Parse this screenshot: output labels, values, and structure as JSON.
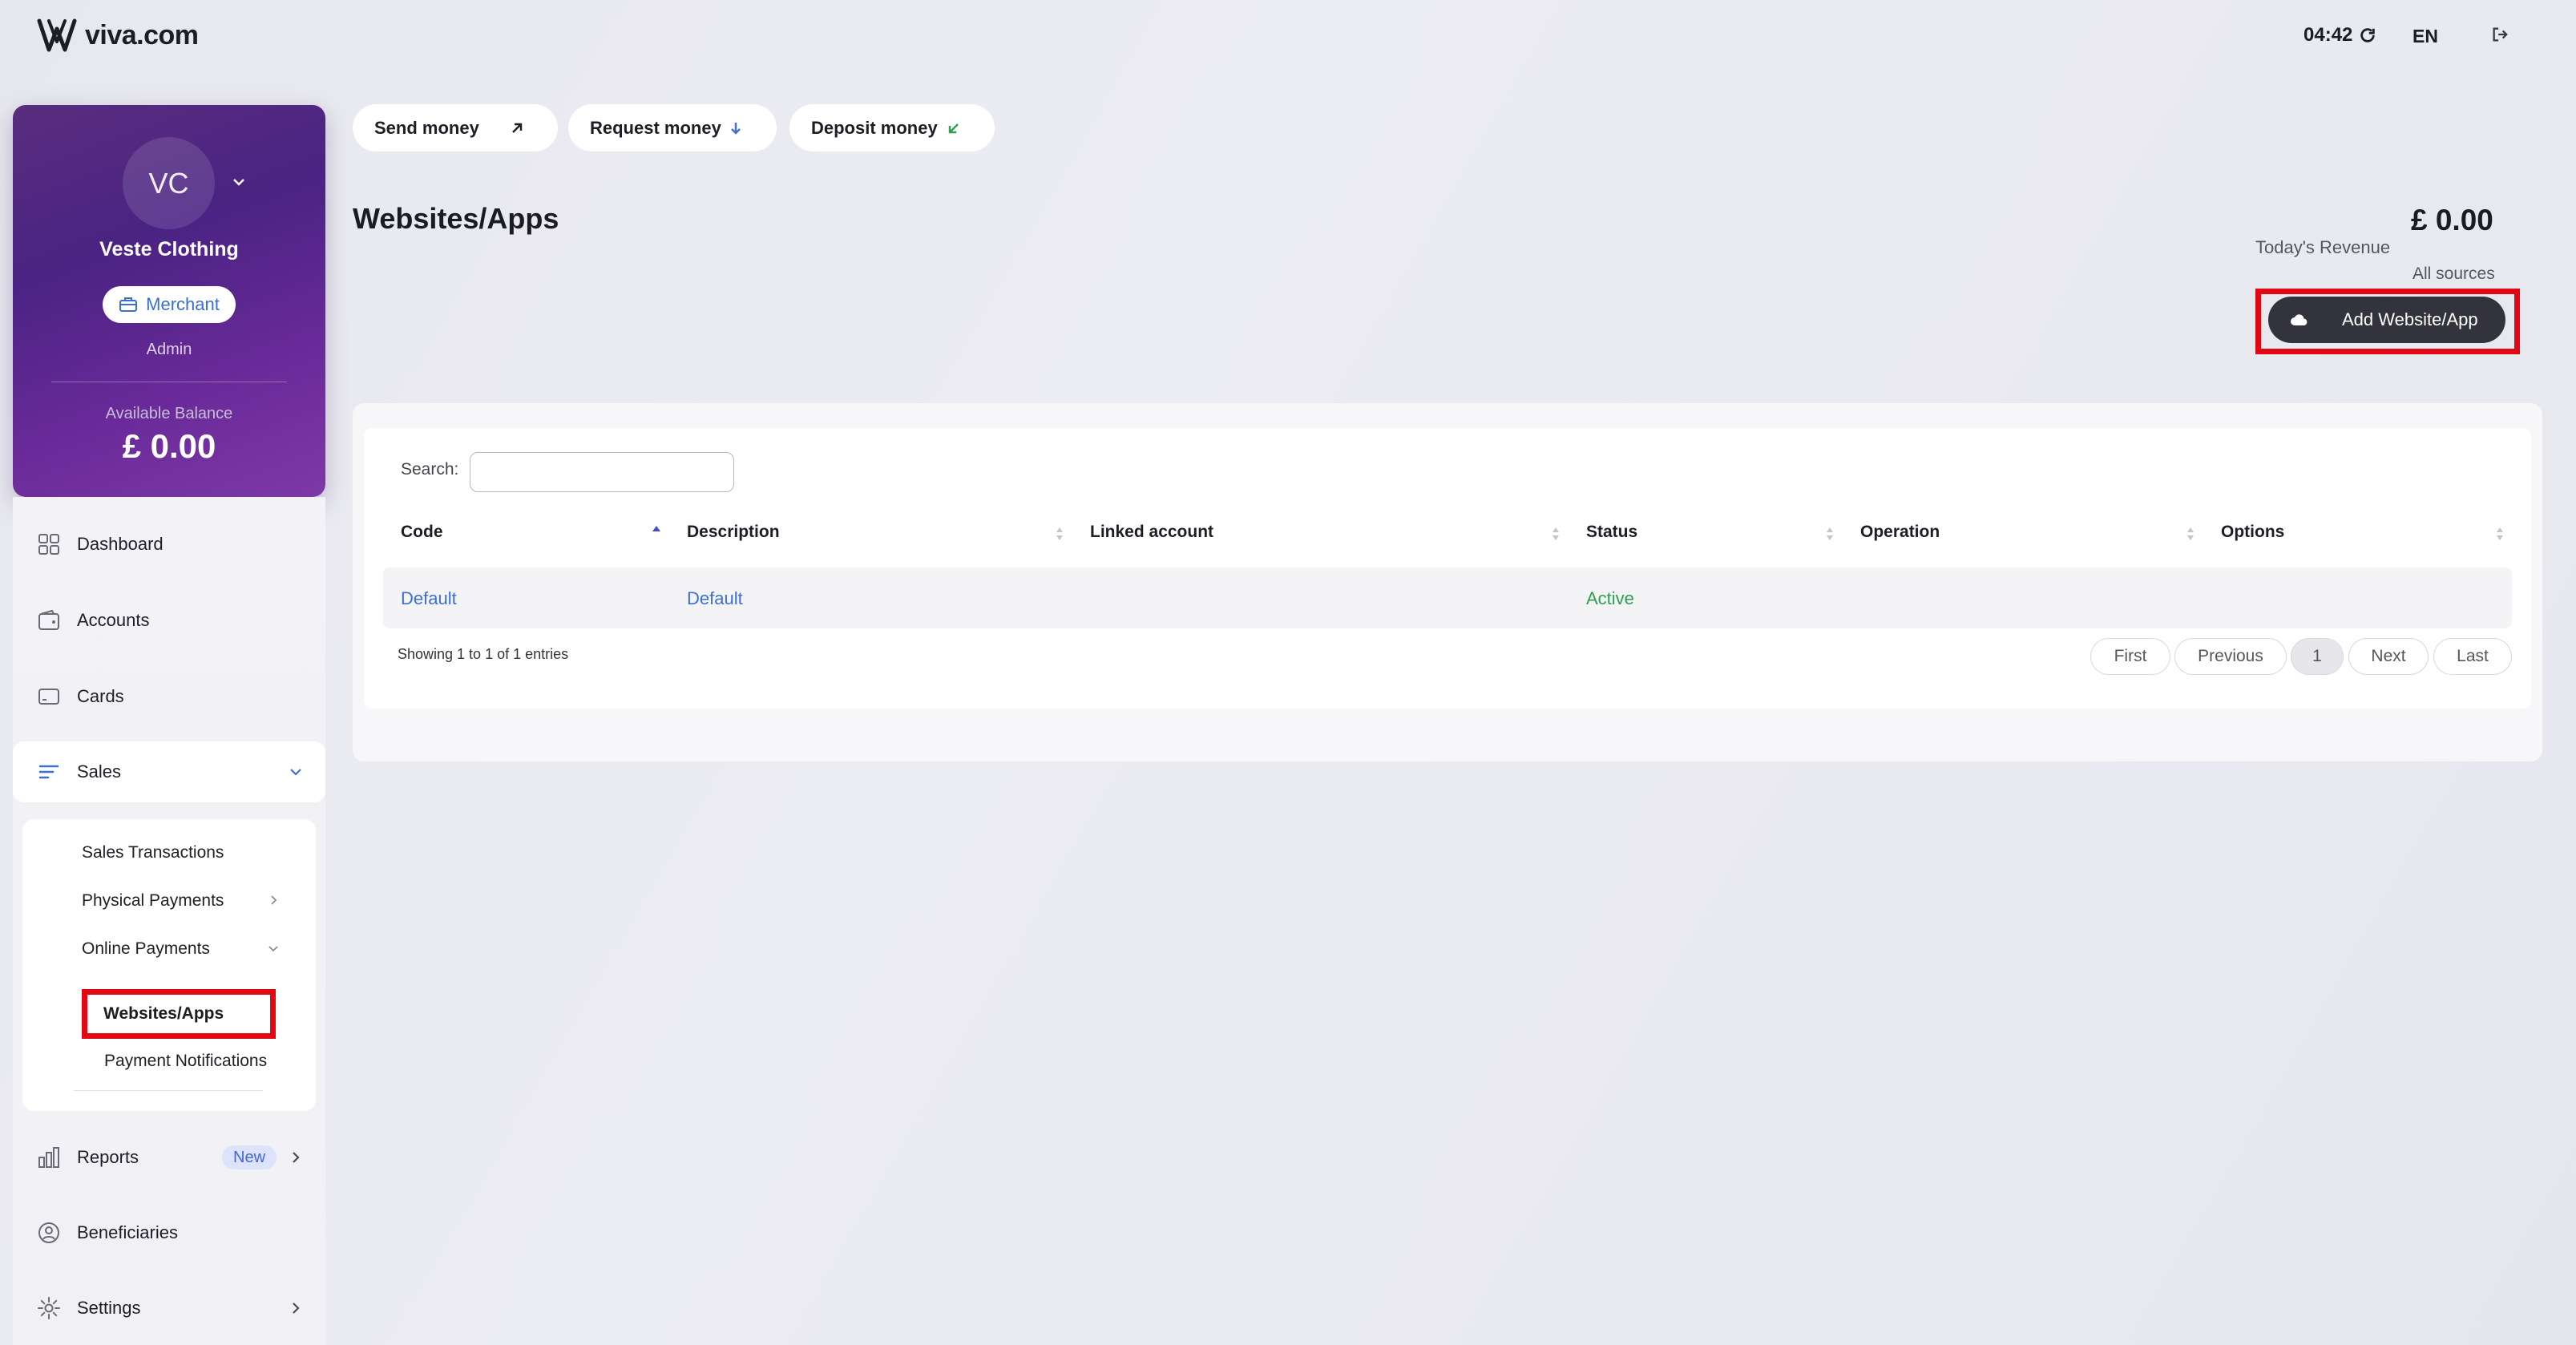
{
  "brand": {
    "name": "viva.com"
  },
  "topbar": {
    "time": "04:42",
    "language": "EN"
  },
  "profile": {
    "initials": "VC",
    "company": "Veste Clothing",
    "account_type": "Merchant",
    "role": "Admin",
    "balance_label": "Available Balance",
    "balance_value": "£ 0.00"
  },
  "nav": {
    "dashboard": "Dashboard",
    "accounts": "Accounts",
    "cards": "Cards",
    "sales": "Sales",
    "sales_sub": {
      "transactions": "Sales Transactions",
      "physical": "Physical Payments",
      "online": "Online Payments",
      "websites": "Websites/Apps",
      "notifications": "Payment Notifications"
    },
    "reports": "Reports",
    "reports_badge": "New",
    "beneficiaries": "Beneficiaries",
    "settings": "Settings"
  },
  "actions": {
    "send": "Send money",
    "request": "Request money",
    "deposit": "Deposit money"
  },
  "page": {
    "title": "Websites/Apps",
    "revenue_value": "£ 0.00",
    "revenue_label": "Today's Revenue",
    "revenue_sources": "All sources",
    "add_button": "Add Website/App"
  },
  "table": {
    "search_label": "Search:",
    "search_value": "",
    "columns": [
      "Code",
      "Description",
      "Linked account",
      "Status",
      "Operation",
      "Options"
    ],
    "rows": [
      {
        "code": "Default",
        "description": "Default",
        "linked_account": "",
        "status": "Active",
        "operation": "",
        "options": ""
      }
    ],
    "info": "Showing 1 to 1 of 1 entries",
    "pagination": {
      "first": "First",
      "previous": "Previous",
      "current": "1",
      "next": "Next",
      "last": "Last"
    }
  },
  "colors": {
    "accent": "#3d6fd4",
    "highlight": "#e30613",
    "active_status": "#2e9e4f",
    "card_gradient_start": "#5a2d7e",
    "card_gradient_end": "#7d3aa6"
  }
}
